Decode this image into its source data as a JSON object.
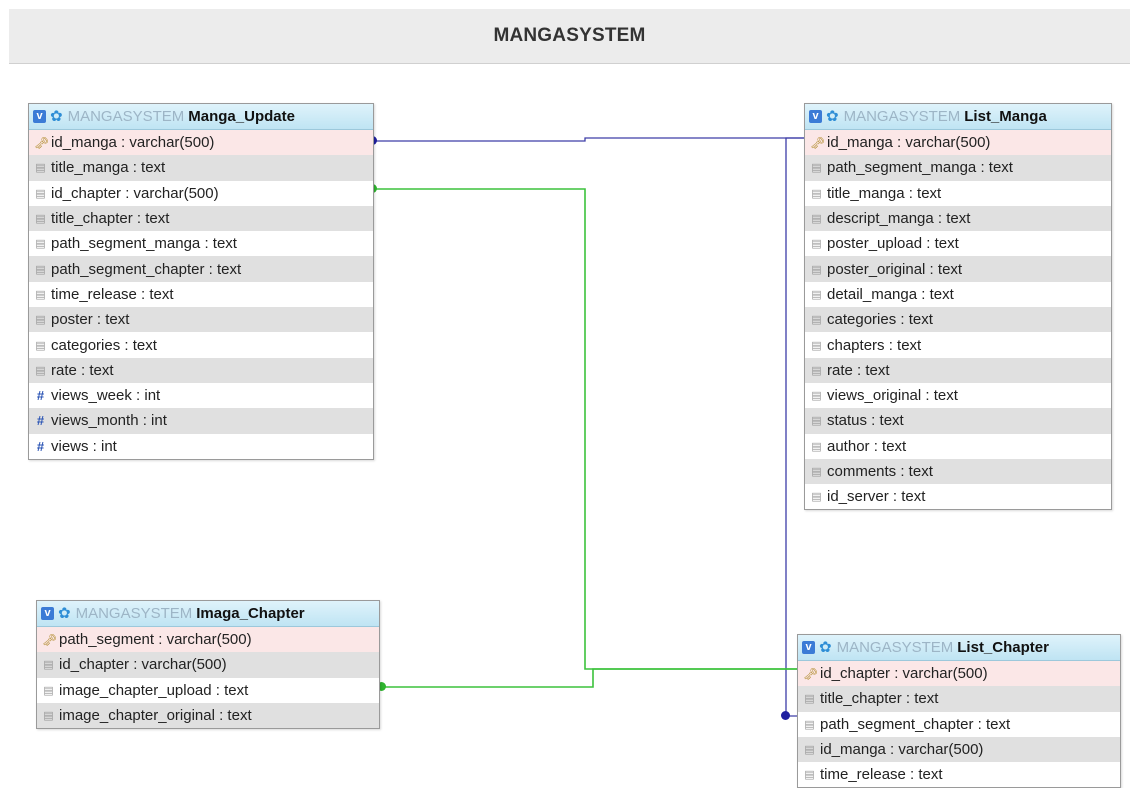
{
  "header": {
    "title": "MANGASYSTEM"
  },
  "tables": {
    "manga_update": {
      "db": "MANGASYSTEM",
      "name": "Manga_Update",
      "columns": [
        "id_manga : varchar(500)",
        "title_manga : text",
        "id_chapter : varchar(500)",
        "title_chapter : text",
        "path_segment_manga : text",
        "path_segment_chapter : text",
        "time_release : text",
        "poster : text",
        "categories : text",
        "rate : text",
        "views_week : int",
        "views_month : int",
        "views : int"
      ]
    },
    "list_manga": {
      "db": "MANGASYSTEM",
      "name": "List_Manga",
      "columns": [
        "id_manga : varchar(500)",
        "path_segment_manga : text",
        "title_manga : text",
        "descript_manga : text",
        "poster_upload : text",
        "poster_original : text",
        "detail_manga : text",
        "categories : text",
        "chapters : text",
        "rate : text",
        "views_original : text",
        "status : text",
        "author : text",
        "comments : text",
        "id_server : text"
      ]
    },
    "imaga_chapter": {
      "db": "MANGASYSTEM",
      "name": "Imaga_Chapter",
      "columns": [
        "path_segment : varchar(500)",
        "id_chapter : varchar(500)",
        "image_chapter_upload : text",
        "image_chapter_original : text"
      ]
    },
    "list_chapter": {
      "db": "MANGASYSTEM",
      "name": "List_Chapter",
      "columns": [
        "id_chapter : varchar(500)",
        "title_chapter : text",
        "path_segment_chapter : text",
        "id_manga : varchar(500)",
        "time_release : text"
      ]
    }
  },
  "colors": {
    "relation_blue": "#3d3da8",
    "relation_green": "#3cc23c"
  }
}
